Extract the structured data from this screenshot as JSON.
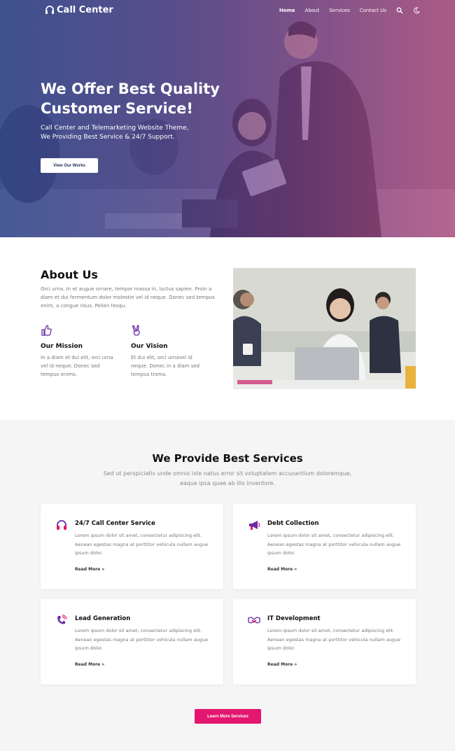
{
  "brand": {
    "name": "Call Center",
    "accent": "#e3176f",
    "navy": "#1d2a5a",
    "purple": "#6b2aa6"
  },
  "nav": {
    "items": [
      "Home",
      "About",
      "Services",
      "Contact Us"
    ],
    "icons": [
      "search-icon",
      "moon-icon"
    ]
  },
  "hero": {
    "title": "We Offer Best Quality Customer Service!",
    "subtitle_line1": "Call Center and Telemarketing Website Theme,",
    "subtitle_line2": "We Providing Best Service & 24/7 Support.",
    "button": "View Our Works"
  },
  "about": {
    "title": "About Us",
    "description": "Orci urna. In et augue ornare, tempor massa in, luctus sapien. Proin a diam et dui fermentum dolor molestie vel id neque. Donec sed tempus enim, a congue risus. Pellen tesqu.",
    "features": [
      {
        "icon": "thumbs-up-icon",
        "title": "Our Mission",
        "text": "In a diam et dui elit, orci urna vel id neque. Donec sed tempus enims."
      },
      {
        "icon": "victory-hand-icon",
        "title": "Our Vision",
        "text": "Et dui elit, orci urnavel id neque. Donec in a diam sed tempus trsma."
      }
    ]
  },
  "services": {
    "title": "We Provide Best Services",
    "subtitle": "Sed ut perspiciatis unde omnis iste natus error sit voluptatem accusantium doloremque, eaque ipsa quae ab illo inventore.",
    "cards": [
      {
        "icon": "headphones-icon",
        "title": "24/7 Call Center Service",
        "text": "Lorem ipsum dolor sit amet, consectetur adipiscing elit. Aenean egestas magna at porttitor vehicula nullam augue ipsum dolor.",
        "link": "Read More »"
      },
      {
        "icon": "megaphone-icon",
        "title": "Debt Collection",
        "text": "Lorem ipsum dolor sit amet, consectetur adipiscing elit. Aenean egestas magna at porttitor vehicula nullam augue ipsum dolor.",
        "link": "Read More »"
      },
      {
        "icon": "phone-ringing-icon",
        "title": "Lead Generation",
        "text": "Lorem ipsum dolor sit amet, consectetur adipiscing elit. Aenean egestas magna at porttitor vehicula nullam augue ipsum dolor.",
        "link": "Read More »"
      },
      {
        "icon": "handshake-icon",
        "title": "IT Development",
        "text": "Lorem ipsum dolor sit amet, consectetur adipiscing elit. Aenean egestas magna at porttitor vehicula nullam augue ipsum dolor.",
        "link": "Read More »"
      }
    ],
    "cta": "Learn More Services"
  }
}
